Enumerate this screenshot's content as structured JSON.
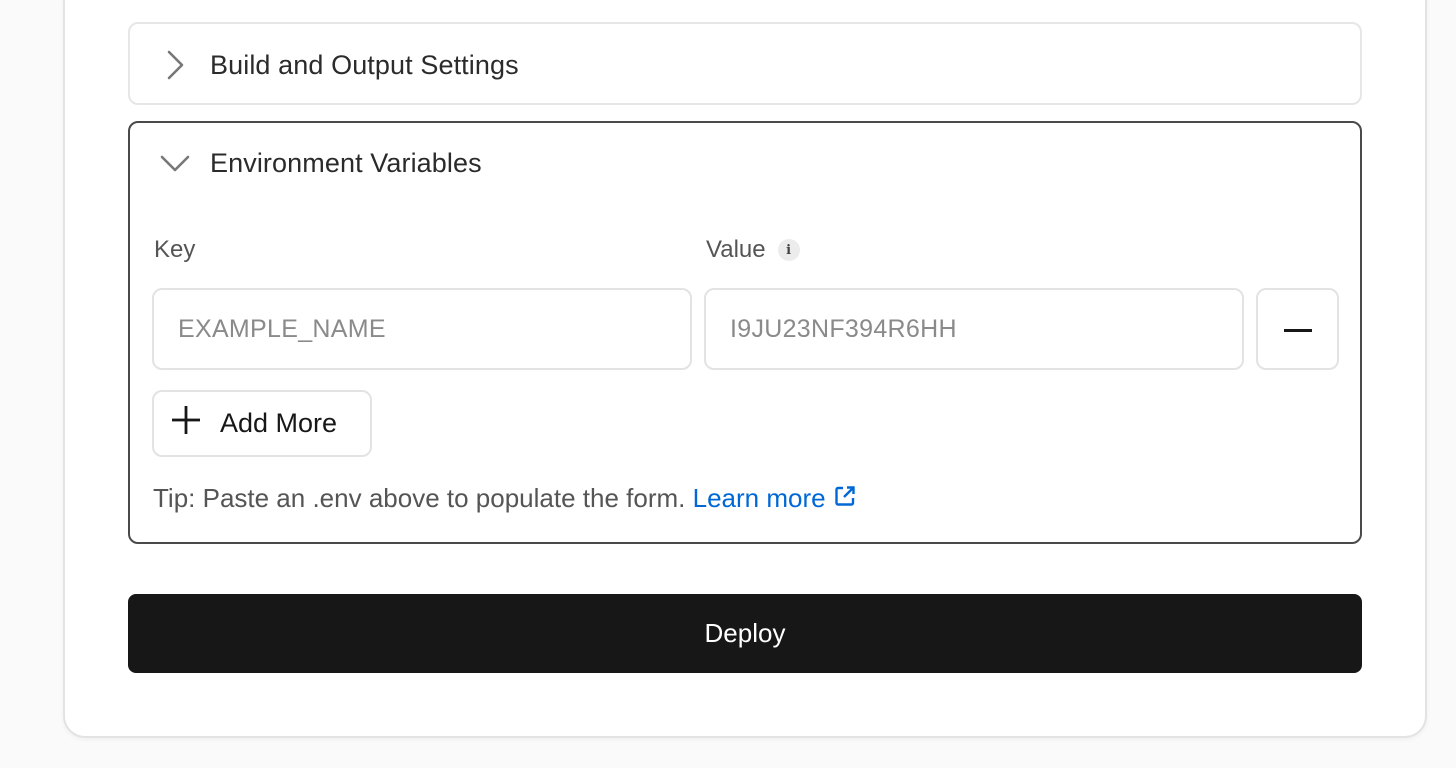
{
  "sections": {
    "build_output": {
      "title": "Build and Output Settings",
      "state": "collapsed",
      "icon": "chevron-right-icon"
    },
    "environment_variables": {
      "title": "Environment Variables",
      "state": "expanded",
      "icon": "chevron-down-icon",
      "key_label": "Key",
      "value_label": "Value",
      "value_info_icon": "info-icon",
      "rows": [
        {
          "key_placeholder": "EXAMPLE_NAME",
          "value_placeholder": "I9JU23NF394R6HH",
          "remove_icon": "minus-icon"
        }
      ],
      "add_more_label": "Add More",
      "add_more_icon": "plus-icon",
      "tip_text": "Tip: Paste an .env above to populate the form.",
      "learn_more_label": "Learn more",
      "learn_more_icon": "external-link-icon"
    }
  },
  "deploy_label": "Deploy",
  "colors": {
    "link": "#0068d6",
    "primary_button": "#171717",
    "expanded_border": "#4a4a4a",
    "border": "#e3e3e3"
  }
}
